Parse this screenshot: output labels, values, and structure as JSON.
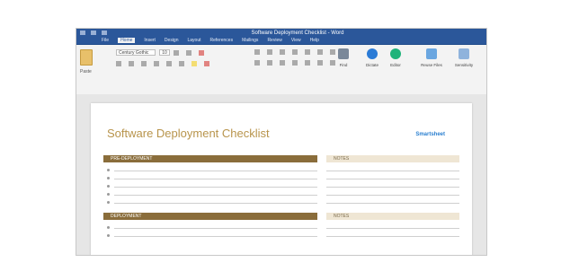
{
  "app": {
    "title": "Software Deployment Checklist - Word"
  },
  "tabs": [
    {
      "label": "File"
    },
    {
      "label": "Home"
    },
    {
      "label": "Insert"
    },
    {
      "label": "Design"
    },
    {
      "label": "Layout"
    },
    {
      "label": "References"
    },
    {
      "label": "Mailings"
    },
    {
      "label": "Review"
    },
    {
      "label": "View"
    },
    {
      "label": "Help"
    }
  ],
  "ribbon": {
    "paste_label": "Paste",
    "font_name": "Century Gothic",
    "font_size": "10",
    "find_label": "Find",
    "dictate_label": "Dictate",
    "editor_label": "Editor",
    "reuse_label": "Reuse Files",
    "sensitivity_label": "Sensitivity"
  },
  "document": {
    "title": "Software Deployment Checklist",
    "logo_top": "Smartsheet",
    "section1_header": "PRE-DEPLOYMENT",
    "section1_side": "NOTES",
    "section2_header": "DEPLOYMENT",
    "section2_side": "NOTES"
  },
  "colors": {
    "accent": "#2b579a",
    "section": "#8a6d3b",
    "section_light": "#efe6d4",
    "title": "#b8944c"
  }
}
